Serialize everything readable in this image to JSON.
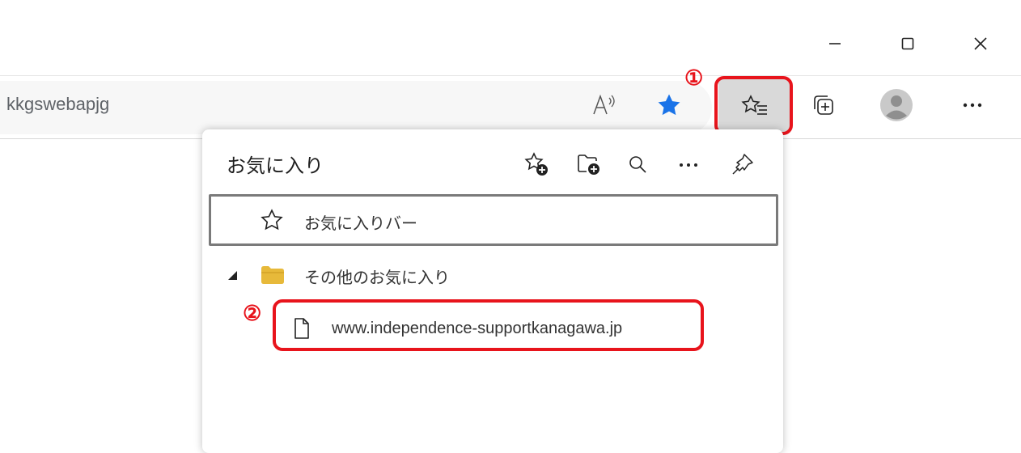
{
  "window": {
    "minimize_icon": "minimize-icon",
    "maximize_icon": "maximize-icon",
    "close_icon": "close-icon"
  },
  "address_bar": {
    "url_text": "kkgswebapjg"
  },
  "toolbar": {
    "read_aloud_icon": "read-aloud-icon",
    "favorite_star_icon": "star-filled-icon",
    "favorites_button_icon": "favorites-list-icon",
    "collections_icon": "collections-icon",
    "profile_icon": "avatar-icon",
    "more_icon": "ellipsis-icon",
    "accent_color": "#1a73e8"
  },
  "annotations": {
    "step1": "①",
    "step2": "②",
    "color": "#e8141c"
  },
  "favorites_panel": {
    "title": "お気に入り",
    "actions": [
      "add-favorite-icon",
      "add-folder-icon",
      "search-icon",
      "ellipsis-icon",
      "pin-icon"
    ],
    "favorites_bar_label": "お気に入りバー",
    "other_folder_label": "その他のお気に入り",
    "item_url": "www.independence-supportkanagawa.jp",
    "folder_color": "#e7b93a"
  }
}
